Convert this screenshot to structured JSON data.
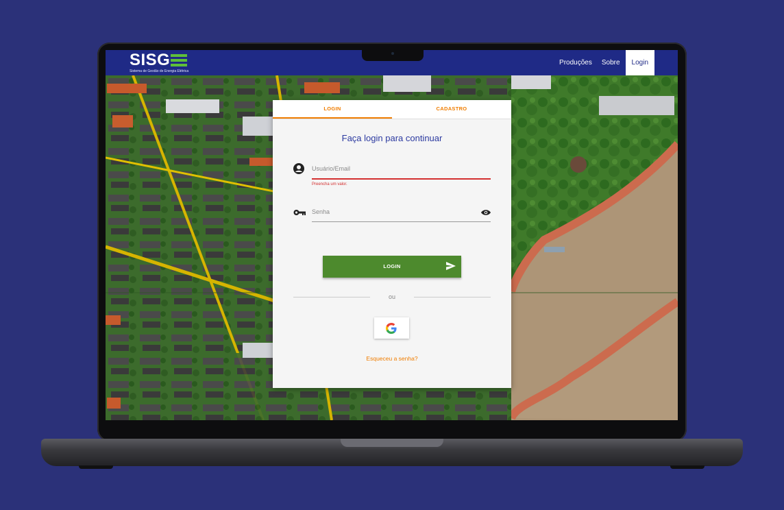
{
  "brand": {
    "name": "SISG",
    "subtitle": "Sistema de Gestão de Energia Elétrica"
  },
  "nav": {
    "items": [
      "Produções",
      "Sobre"
    ],
    "active": "Login"
  },
  "tabs": {
    "login": "LOGIN",
    "signup": "CADASTRO"
  },
  "form": {
    "title": "Faça login para continuar",
    "user_placeholder": "Usuário/Email",
    "user_error": "Preencha um valor.",
    "password_placeholder": "Senha",
    "submit_label": "LOGIN",
    "or_text": "ou",
    "forgot_label": "Esqueceu a senha?"
  },
  "colors": {
    "page_bg": "#2b3179",
    "navbar": "#1f2a86",
    "accent_orange": "#f07d00",
    "login_green": "#4d8a2d",
    "error_red": "#d32f2f",
    "logo_green": "#5fbf3a"
  },
  "icons": [
    "user-circle-icon",
    "key-icon",
    "eye-icon",
    "send-icon",
    "google-icon"
  ]
}
